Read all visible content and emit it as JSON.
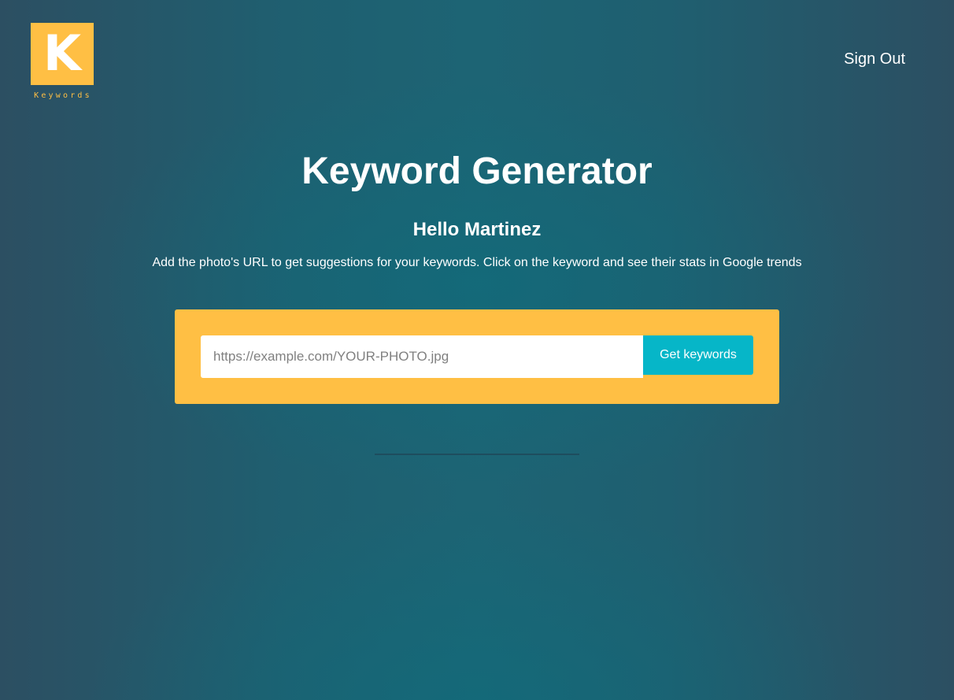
{
  "logo": {
    "letter": "K",
    "text": "Keywords",
    "color": "#ffbf44"
  },
  "header": {
    "signout_label": "Sign Out"
  },
  "main": {
    "title": "Keyword Generator",
    "greeting": "Hello Martinez",
    "instructions": "Add the photo's URL to get suggestions for your keywords. Click on the keyword and see their stats in Google trends"
  },
  "search": {
    "placeholder": "https://example.com/YOUR-PHOTO.jpg",
    "value": "",
    "button_label": "Get keywords"
  },
  "colors": {
    "accent": "#ffbf44",
    "button": "#06b6c8",
    "background": "#1f5f70"
  }
}
